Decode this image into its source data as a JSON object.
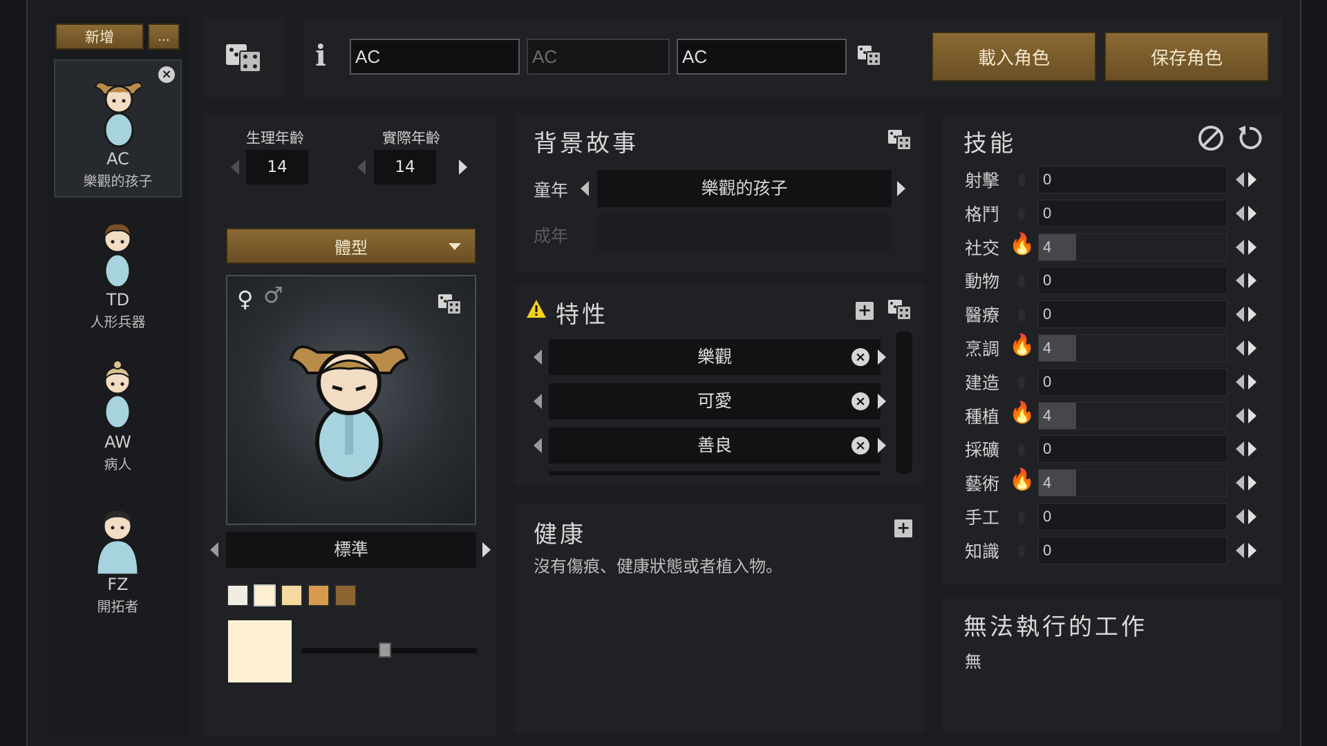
{
  "sidebar": {
    "add_label": "新增",
    "more_label": "...",
    "pawns": [
      {
        "code": "AC",
        "title": "樂觀的孩子",
        "selected": true
      },
      {
        "code": "TD",
        "title": "人形兵器"
      },
      {
        "code": "AW",
        "title": "病人"
      },
      {
        "code": "FZ",
        "title": "開拓者"
      }
    ]
  },
  "header": {
    "info_icon": "i",
    "first_name": "AC",
    "nick_name_placeholder": "AC",
    "last_name": "AC",
    "load_label": "載入角色",
    "save_label": "保存角色"
  },
  "age": {
    "bio_label": "生理年齡",
    "bio_value": "14",
    "chrono_label": "實際年齡",
    "chrono_value": "14"
  },
  "appearance": {
    "bodytype_label": "體型",
    "female_symbol": "♀",
    "male_symbol": "♂",
    "hair_label": "標準",
    "skin_colors": [
      "#f1ece2",
      "#fdf0d3",
      "#f4d9a0",
      "#d99a4f",
      "#8c6432"
    ],
    "selected_skin": "#fdf0d3"
  },
  "backstory": {
    "title": "背景故事",
    "childhood_label": "童年",
    "childhood_value": "樂觀的孩子",
    "adulthood_label": "成年",
    "adulthood_value": ""
  },
  "traits": {
    "title": "特性",
    "items": [
      "樂觀",
      "可愛",
      "善良"
    ]
  },
  "health": {
    "title": "健康",
    "text": "沒有傷痕、健康狀態或者植入物。"
  },
  "skills": {
    "title": "技能",
    "items": [
      {
        "name": "射擊",
        "value": "0",
        "passion": false
      },
      {
        "name": "格鬥",
        "value": "0",
        "passion": false
      },
      {
        "name": "社交",
        "value": "4",
        "passion": true
      },
      {
        "name": "動物",
        "value": "0",
        "passion": false
      },
      {
        "name": "醫療",
        "value": "0",
        "passion": false
      },
      {
        "name": "烹調",
        "value": "4",
        "passion": true
      },
      {
        "name": "建造",
        "value": "0",
        "passion": false
      },
      {
        "name": "種植",
        "value": "4",
        "passion": true
      },
      {
        "name": "採礦",
        "value": "0",
        "passion": false
      },
      {
        "name": "藝術",
        "value": "4",
        "passion": true
      },
      {
        "name": "手工",
        "value": "0",
        "passion": false
      },
      {
        "name": "知識",
        "value": "0",
        "passion": false
      }
    ]
  },
  "incapable": {
    "title": "無法執行的工作",
    "value": "無"
  }
}
